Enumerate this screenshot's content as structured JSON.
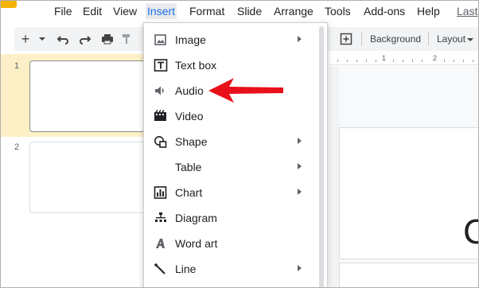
{
  "menubar": {
    "items": [
      "File",
      "Edit",
      "View",
      "Insert",
      "Format",
      "Slide",
      "Arrange",
      "Tools",
      "Add-ons",
      "Help"
    ],
    "last_edit": "Last"
  },
  "toolbar": {
    "background_label": "Background",
    "layout_label": "Layout"
  },
  "filmstrip": {
    "slides": [
      "1",
      "2"
    ]
  },
  "ruler": {
    "marks": [
      "1",
      "2"
    ]
  },
  "canvas": {
    "visible_text": "C"
  },
  "insert_menu": {
    "items": [
      {
        "label": "Image",
        "icon": "image-icon",
        "submenu": true
      },
      {
        "label": "Text box",
        "icon": "text-box-icon",
        "submenu": false
      },
      {
        "label": "Audio",
        "icon": "audio-icon",
        "submenu": false
      },
      {
        "label": "Video",
        "icon": "video-icon",
        "submenu": false
      },
      {
        "label": "Shape",
        "icon": "shape-icon",
        "submenu": true
      },
      {
        "label": "Table",
        "icon": "",
        "submenu": true
      },
      {
        "label": "Chart",
        "icon": "chart-icon",
        "submenu": true
      },
      {
        "label": "Diagram",
        "icon": "diagram-icon",
        "submenu": false
      },
      {
        "label": "Word art",
        "icon": "word-art-icon",
        "submenu": false
      },
      {
        "label": "Line",
        "icon": "line-icon",
        "submenu": true
      }
    ]
  },
  "colors": {
    "accent_blue": "#1a73e8",
    "selected_slide_bg": "#fdf0c7",
    "annotation_red": "#e8101a",
    "logo_yellow": "#f4b400"
  }
}
